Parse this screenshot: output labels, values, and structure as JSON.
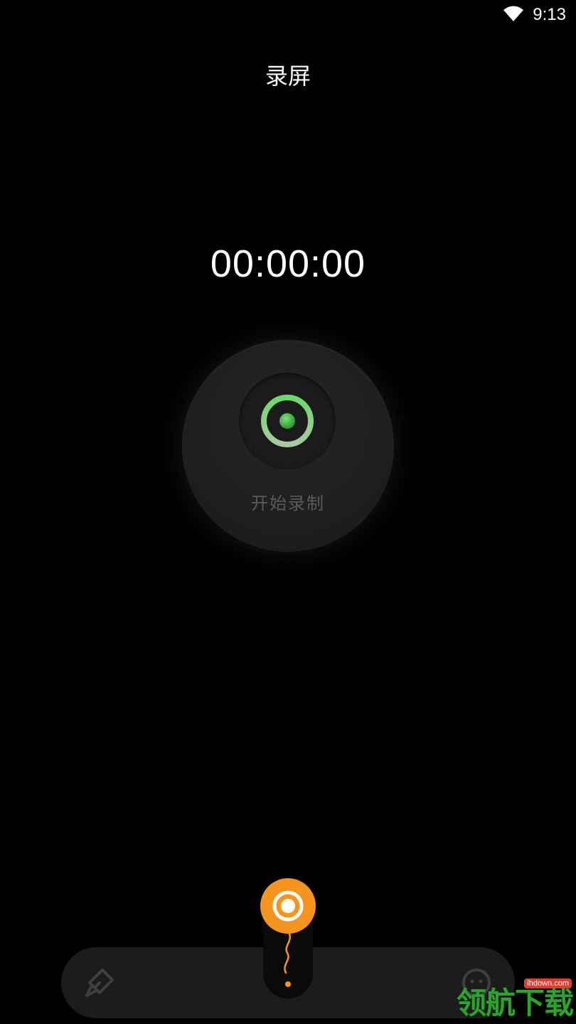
{
  "status_bar": {
    "time": "9:13",
    "icons": [
      "wifi-icon"
    ]
  },
  "header": {
    "title": "录屏"
  },
  "recorder": {
    "timer": "00:00:00",
    "start_label": "开始录制",
    "accent_color": "#5cc85a"
  },
  "bottom_bar": {
    "left_icon": "brush-icon",
    "right_icon": "face-icon",
    "center_icon": "record-float-icon",
    "center_color": "#f7941d"
  },
  "watermark": {
    "text": "领航下载",
    "domain": "lhdown.com"
  }
}
